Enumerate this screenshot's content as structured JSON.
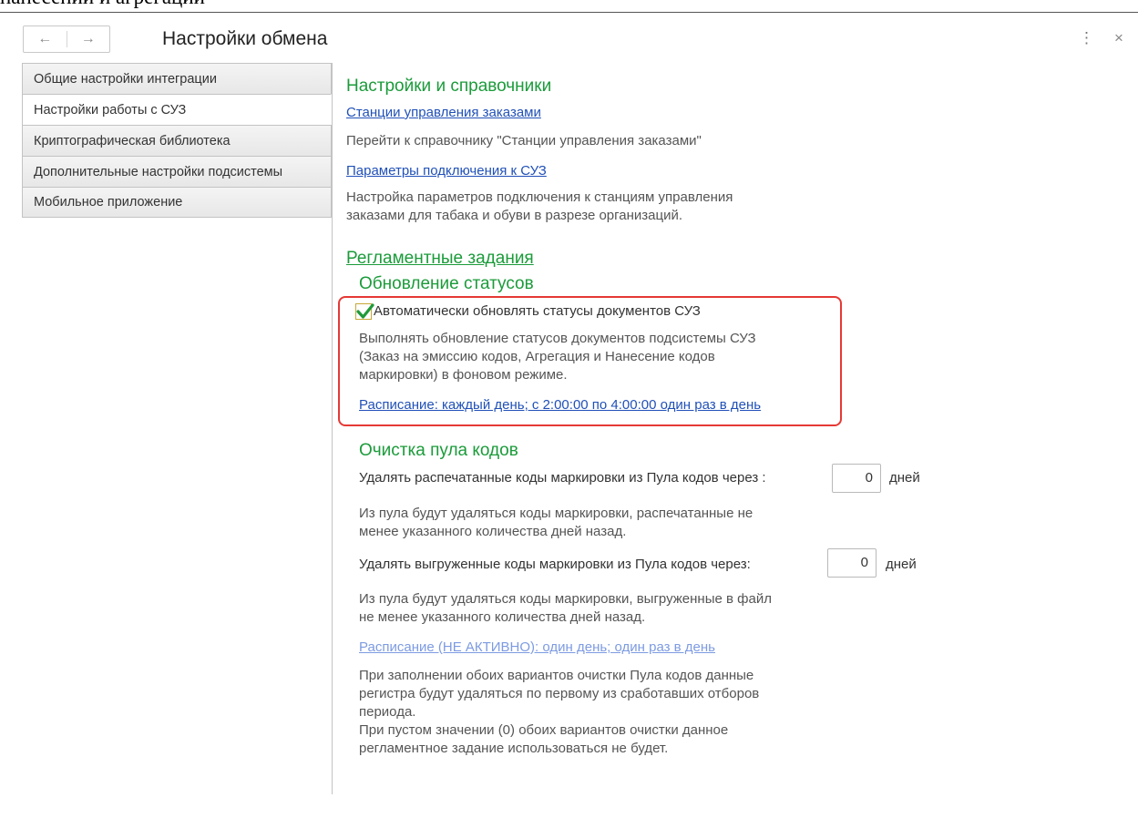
{
  "document_fragment": "нанесении и агрегации",
  "window": {
    "title": "Настройки обмена",
    "back_icon": "←",
    "forward_icon": "→",
    "more_icon": "⋮",
    "close_icon": "×"
  },
  "tabs": [
    {
      "label": "Общие настройки интеграции"
    },
    {
      "label": "Настройки работы с СУЗ",
      "active": true
    },
    {
      "label": "Криптографическая библиотека"
    },
    {
      "label": "Дополнительные настройки подсистемы"
    },
    {
      "label": "Мобильное приложение"
    }
  ],
  "content": {
    "section1": {
      "title": "Настройки и справочники",
      "link1": "Станции управления заказами",
      "desc1": "Перейти к справочнику \"Станции управления заказами\"",
      "link2": "Параметры подключения к СУЗ",
      "desc2_line1": "Настройка параметров подключения к станциям управления",
      "desc2_line2": "заказами для табака и обуви в разрезе организаций."
    },
    "section2": {
      "title": "Регламентные задания",
      "status_update": {
        "title": "Обновление статусов",
        "checkbox_label": "Автоматически обновлять статусы документов СУЗ",
        "checkbox_checked": true,
        "desc_line1": "Выполнять обновление статусов документов подсистемы СУЗ",
        "desc_line2": "(Заказ на эмиссию кодов, Агрегация и Нанесение кодов",
        "desc_line3": "маркировки) в фоновом режиме.",
        "schedule_link": "Расписание: каждый день; с 2:00:00 по 4:00:00 один раз в день"
      },
      "pool_cleanup": {
        "title": "Очистка пула кодов",
        "printed_label": "Удалять распечатанные коды маркировки из Пула кодов через :",
        "printed_value": "0",
        "printed_unit": "дней",
        "printed_desc_line1": "Из пула будут удаляться коды маркировки, распечатанные не",
        "printed_desc_line2": "менее указанного количества дней назад.",
        "exported_label": "Удалять выгруженные коды маркировки из Пула кодов через:",
        "exported_value": "0",
        "exported_unit": "дней",
        "exported_desc_line1": "Из пула будут удаляться коды маркировки, выгруженные в файл",
        "exported_desc_line2": "не менее указанного количества дней назад.",
        "schedule_link": "Расписание (НЕ АКТИВНО): один день; один раз в день",
        "note_line1": "При заполнении обоих вариантов очистки Пула кодов данные",
        "note_line2": "регистра будут удаляться по первому из сработавших отборов",
        "note_line3": "периода.",
        "note_line4": "При пустом значении (0) обоих вариантов очистки данное",
        "note_line5": "регламентное задание использоваться не будет."
      }
    }
  },
  "colors": {
    "heading_green": "#1b9b3a",
    "link_blue": "#2050b8",
    "link_inactive": "#7d9be2",
    "highlight_red": "#e53935",
    "checkmark_green": "#1f9a3a"
  }
}
